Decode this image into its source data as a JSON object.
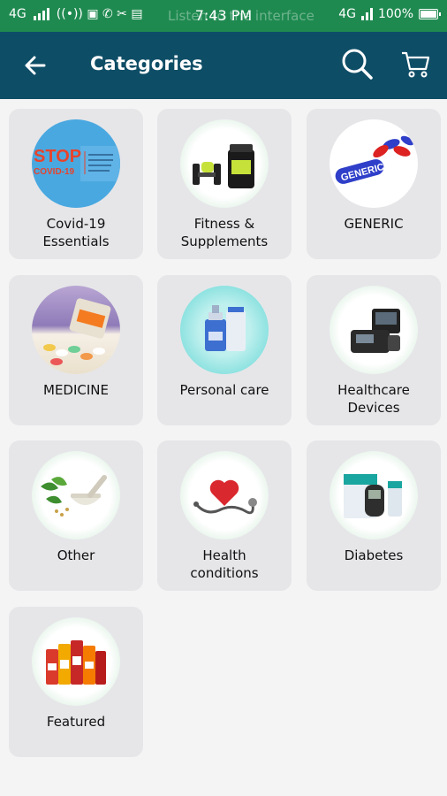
{
  "status_bar": {
    "network": "4G",
    "time": "7:43 PM",
    "ghost_text": "Listen to the interface",
    "volte": "4G",
    "battery": "100%"
  },
  "app_bar": {
    "title": "Categories",
    "back_icon": "arrow-left-icon",
    "search_icon": "search-icon",
    "cart_icon": "cart-icon"
  },
  "categories": [
    {
      "label": "Covid-19\nEssentials",
      "image": "stop-covid19-image"
    },
    {
      "label": "Fitness &\nSupplements",
      "image": "dumbbell-supplement-image"
    },
    {
      "label": "GENERIC",
      "image": "generic-pills-image"
    },
    {
      "label": "MEDICINE",
      "image": "medicine-bottle-image"
    },
    {
      "label": "Personal care",
      "image": "personal-care-image"
    },
    {
      "label": "Healthcare\nDevices",
      "image": "healthcare-device-image"
    },
    {
      "label": "Other",
      "image": "herbal-mortar-image"
    },
    {
      "label": "Health\nconditions",
      "image": "heart-stethoscope-image"
    },
    {
      "label": "Diabetes",
      "image": "glucometer-image"
    },
    {
      "label": "Featured",
      "image": "featured-products-image"
    }
  ],
  "thumb_text": {
    "stop": "STOP",
    "covid": "COVID-19",
    "generic": "GENERIC"
  }
}
